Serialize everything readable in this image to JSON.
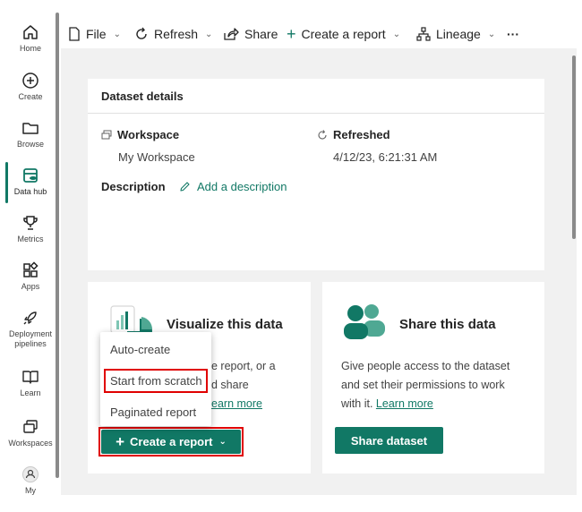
{
  "nav": {
    "items": [
      {
        "label": "Home",
        "icon": "home-icon"
      },
      {
        "label": "Create",
        "icon": "plus-circle-icon"
      },
      {
        "label": "Browse",
        "icon": "folder-icon"
      },
      {
        "label": "Data hub",
        "icon": "database-icon"
      },
      {
        "label": "Metrics",
        "icon": "trophy-icon"
      },
      {
        "label": "Apps",
        "icon": "apps-icon"
      },
      {
        "label": "Deployment pipelines",
        "icon": "rocket-icon"
      },
      {
        "label": "Learn",
        "icon": "book-icon"
      },
      {
        "label": "Workspaces",
        "icon": "workspaces-icon"
      },
      {
        "label": "My",
        "icon": "person-icon"
      }
    ],
    "active": "Data hub"
  },
  "toolbar": {
    "file": "File",
    "refresh": "Refresh",
    "share": "Share",
    "create_report": "Create a report",
    "lineage": "Lineage",
    "more": "···"
  },
  "details": {
    "title": "Dataset details",
    "workspace_label": "Workspace",
    "workspace_value": "My Workspace",
    "refreshed_label": "Refreshed",
    "refreshed_value": "4/12/23, 6:21:31 AM",
    "description_label": "Description",
    "add_description": "Add a description"
  },
  "visualize": {
    "title": "Visualize this data",
    "text_line1": "e report, or a",
    "text_line2": "d share",
    "learn_more": "earn more",
    "button": "Create a report"
  },
  "menu": {
    "items": [
      "Auto-create",
      "Start from scratch",
      "Paginated report"
    ]
  },
  "share_card": {
    "title": "Share this data",
    "text_line1": "Give people access to the dataset",
    "text_line2": "and set their permissions to work",
    "text_line3": "with it.",
    "learn_more": "Learn more",
    "button": "Share dataset"
  },
  "colors": {
    "accent": "#117865",
    "highlight": "#e00000",
    "background": "#f1f1f1"
  }
}
